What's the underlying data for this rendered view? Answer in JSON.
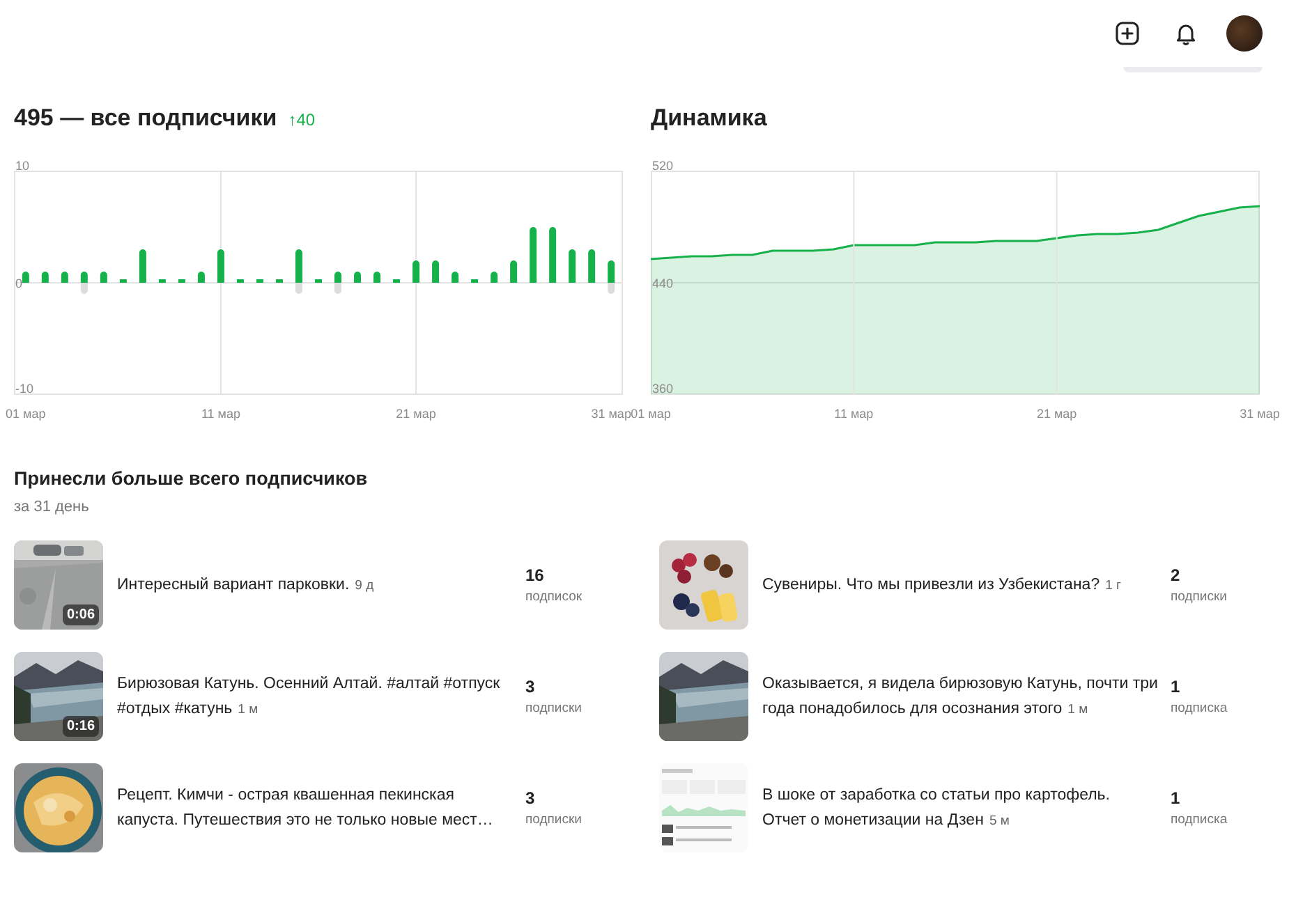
{
  "header_actions": [
    {
      "kind": "add"
    },
    {
      "kind": "notifications"
    },
    {
      "kind": "avatar"
    }
  ],
  "subscribers_panel": {
    "count": "495 — все подписчики",
    "change_arrow": "↑",
    "change": "40",
    "chart_data": {
      "type": "bar",
      "x": [
        1,
        2,
        3,
        4,
        5,
        6,
        7,
        8,
        9,
        10,
        11,
        12,
        13,
        14,
        15,
        16,
        17,
        18,
        19,
        20,
        21,
        22,
        23,
        24,
        25,
        26,
        27,
        28,
        29,
        30,
        31
      ],
      "xlim": [
        0.4,
        31.6
      ],
      "ylim": [
        -10,
        10
      ],
      "grid": true,
      "yticks": [
        {
          "value": 10,
          "label": "10"
        },
        {
          "value": 0,
          "label": "0"
        },
        {
          "value": -10,
          "label": "-10"
        }
      ],
      "xticks": [
        {
          "value": 1,
          "label": "01 мар"
        },
        {
          "value": 11,
          "label": "11 мар"
        },
        {
          "value": 21,
          "label": "21 мар"
        },
        {
          "value": 31,
          "label": "31 мар"
        }
      ],
      "stacked": true,
      "series": [
        {
          "color": "#16b14b",
          "values": [
            1,
            1,
            1,
            1,
            1,
            0,
            3,
            0,
            0,
            1,
            3,
            0,
            0,
            0,
            3,
            0,
            1,
            1,
            1,
            0,
            2,
            2,
            1,
            0,
            1,
            2,
            5,
            5,
            3,
            3,
            2
          ]
        },
        {
          "color": "#dcdcdc",
          "values": [
            0,
            0,
            0,
            -1,
            0,
            0,
            0,
            0,
            0,
            0,
            0,
            0,
            0,
            0,
            -1,
            0,
            -1,
            0,
            0,
            0,
            0,
            0,
            0,
            0,
            0,
            0,
            0,
            0,
            0,
            0,
            -1
          ]
        }
      ]
    }
  },
  "dynamics_panel": {
    "title": "Динамика",
    "chart_data": {
      "type": "area",
      "x": [
        1,
        2,
        3,
        4,
        5,
        6,
        7,
        8,
        9,
        10,
        11,
        12,
        13,
        14,
        15,
        16,
        17,
        18,
        19,
        20,
        21,
        22,
        23,
        24,
        25,
        26,
        27,
        28,
        29,
        30,
        31
      ],
      "xlim": [
        1,
        31
      ],
      "ylim": [
        360,
        520
      ],
      "grid": true,
      "yticks": [
        {
          "value": 520,
          "label": "520"
        },
        {
          "value": 440,
          "label": "440"
        },
        {
          "value": 360,
          "label": "360"
        }
      ],
      "xticks": [
        {
          "value": 1,
          "label": "01 мар"
        },
        {
          "value": 11,
          "label": "11 мар"
        },
        {
          "value": 21,
          "label": "21 мар"
        },
        {
          "value": 31,
          "label": "31 мар"
        }
      ],
      "series": [
        {
          "color": "#16b14b",
          "values": [
            457,
            458,
            459,
            459,
            460,
            460,
            463,
            463,
            463,
            464,
            467,
            467,
            467,
            467,
            469,
            469,
            469,
            470,
            470,
            470,
            472,
            474,
            475,
            475,
            476,
            478,
            483,
            488,
            491,
            494,
            495
          ]
        }
      ]
    }
  },
  "top_posts": {
    "title": "Принесли больше всего подписчиков",
    "period": "за 31 день",
    "items": [
      {
        "duration": "0:06",
        "title": "Интересный вариант парковки.",
        "age": "9 д",
        "count": "16",
        "count_label": "подписок"
      },
      {
        "title": "Сувениры. Что мы привезли из Узбекистана?",
        "age": "1 г",
        "count": "2",
        "count_label": "подписки"
      },
      {
        "duration": "0:16",
        "title": "Бирюзовая Катунь. Осенний Алтай. #алтай #отпуск #отдых #катунь",
        "age": "1 м",
        "count": "3",
        "count_label": "подписки"
      },
      {
        "title": "Оказывается, я видела бирюзовую Катунь, почти три года понадобилось для осознания этого",
        "age": "1 м",
        "count": "1",
        "count_label": "подписка"
      },
      {
        "title": "Рецепт. Кимчи - острая квашенная пекинская капуста. Путешествия это не только новые мест…",
        "count": "3",
        "count_label": "подписки"
      },
      {
        "title": "В шоке от заработка со статьи про картофель. Отчет о монетизации на Дзен",
        "age": "5 м",
        "count": "1",
        "count_label": "подписка"
      }
    ]
  }
}
